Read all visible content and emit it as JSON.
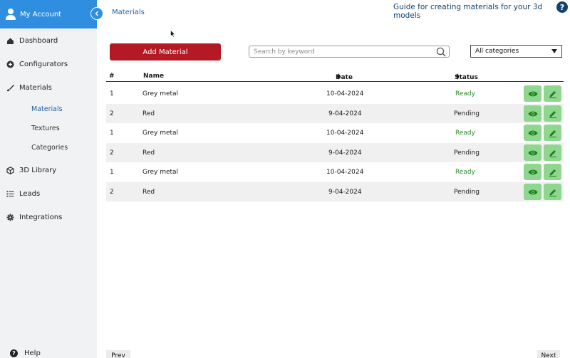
{
  "sidebar": {
    "account_label": "My Account",
    "items": [
      {
        "label": "Dashboard",
        "icon": "home-icon"
      },
      {
        "label": "Configurators",
        "icon": "plus-circle-icon"
      },
      {
        "label": "Materials",
        "icon": "brush-icon"
      },
      {
        "label": "3D Library",
        "icon": "cube-icon"
      },
      {
        "label": "Leads",
        "icon": "list-icon"
      },
      {
        "label": "Integrations",
        "icon": "gear-icon"
      }
    ],
    "sub_items": [
      "Materials",
      "Textures",
      "Categories"
    ],
    "help_label": "Help"
  },
  "header": {
    "breadcrumb": "Materials",
    "guide_link": "Guide for creating materials for your 3d models",
    "help_glyph": "?"
  },
  "toolbar": {
    "add_label": "Add Material",
    "search_placeholder": "Search by keyword",
    "category_selected": "All categories"
  },
  "table": {
    "columns": {
      "num": "#",
      "name": "Name",
      "date": "Date",
      "status": "Status"
    },
    "rows": [
      {
        "num": "1",
        "name": "Grey metal",
        "date": "10-04-2024",
        "status": "Ready"
      },
      {
        "num": "2",
        "name": "Red",
        "date": "9-04-2024",
        "status": "Pending"
      },
      {
        "num": "1",
        "name": "Grey metal",
        "date": "10-04-2024",
        "status": "Ready"
      },
      {
        "num": "2",
        "name": "Red",
        "date": "9-04-2024",
        "status": "Pending"
      },
      {
        "num": "1",
        "name": "Grey metal",
        "date": "10-04-2024",
        "status": "Ready"
      },
      {
        "num": "2",
        "name": "Red",
        "date": "9-04-2024",
        "status": "Pending"
      }
    ]
  },
  "pagination": {
    "prev_label": "Prev",
    "next_label": "Next"
  },
  "colors": {
    "accent": "#2f8ee0",
    "primary_button": "#b51a24",
    "ready": "#2e8b2e",
    "action": "#8fd68f",
    "link": "#1f5d9e"
  }
}
